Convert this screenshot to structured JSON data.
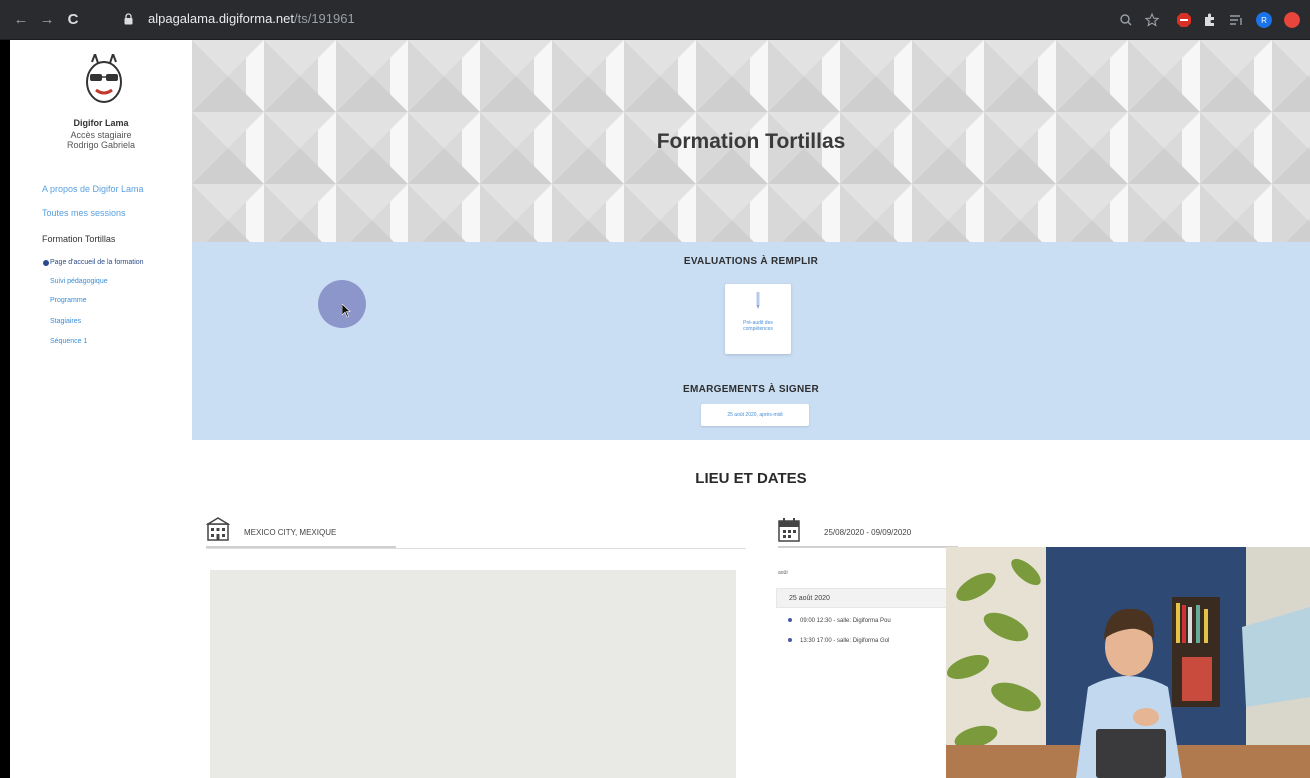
{
  "browser": {
    "back_icon": "←",
    "forward_icon": "→",
    "reload_icon": "C",
    "url_host": "alpagalama.digiforma.net",
    "url_path": "/ts/191961",
    "extensions": [
      "search-icon",
      "star-icon",
      "adblock-icon",
      "puzzle-icon",
      "media-icon",
      "profile-icon"
    ]
  },
  "sidebar": {
    "org_name": "Digifor Lama",
    "access_label": "Accès stagiaire",
    "user_name": "Rodrigo Gabriela",
    "links": [
      "A propos de Digifor Lama",
      "Toutes mes sessions"
    ],
    "current_course": "Formation Tortillas",
    "sub_items": [
      "Page d'accueil de la formation",
      "Suivi pédagogique",
      "Programme",
      "Stagiaires",
      "Séquence 1"
    ]
  },
  "hero": {
    "title": "Formation Tortillas"
  },
  "evaluations": {
    "heading": "EVALUATIONS À REMPLIR",
    "card_label": "Pré-audit des compétences"
  },
  "signatures": {
    "heading": "EMARGEMENTS À SIGNER",
    "button_label": "25 août 2020, après-midi"
  },
  "lieu": {
    "heading": "LIEU ET DATES",
    "location": "MEXICO CITY, MEXIQUE",
    "date_range": "25/08/2020 - 09/09/2020",
    "month": "août",
    "day": "25 août 2020",
    "slots": [
      "09:00 12:30 - salle: Digiforma Pou",
      "13:30 17:00 - salle: Digiforma Gol"
    ]
  },
  "colors": {
    "accent": "#4a8fd6",
    "blue_section": "#c9ddf3",
    "browser_bar": "#2a2b2e"
  }
}
